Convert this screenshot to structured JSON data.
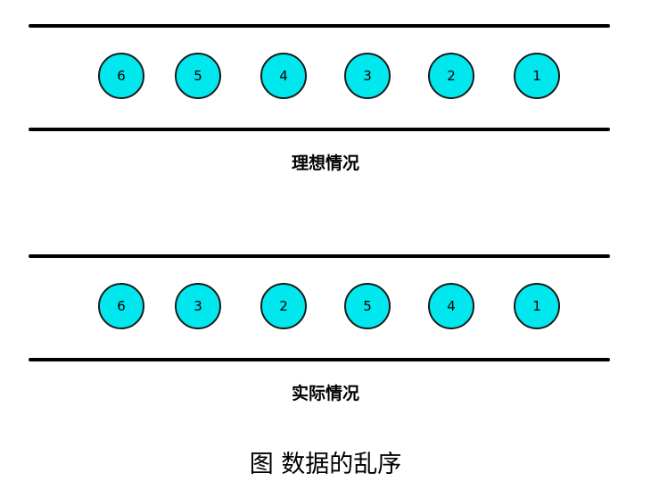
{
  "ideal": {
    "label": "理想情况",
    "packets": [
      "6",
      "5",
      "4",
      "3",
      "2",
      "1"
    ]
  },
  "actual": {
    "label": "实际情况",
    "packets": [
      "6",
      "3",
      "2",
      "5",
      "4",
      "1"
    ]
  },
  "caption": "图 数据的乱序",
  "colors": {
    "packet_fill": "#00e8ee",
    "rail": "#000000"
  }
}
